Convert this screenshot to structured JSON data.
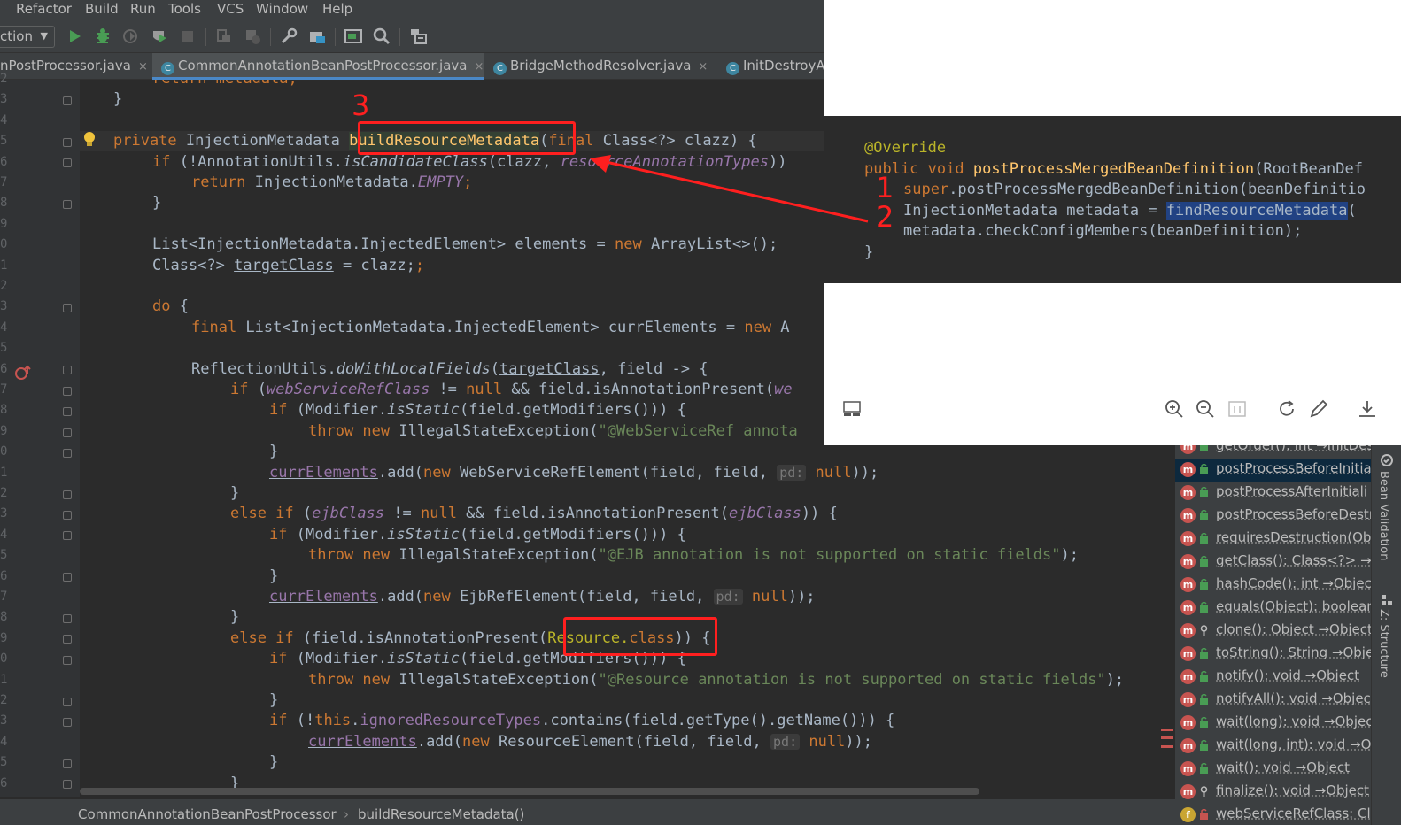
{
  "menu": [
    "Refactor",
    "Build",
    "Run",
    "Tools",
    "VCS",
    "Window",
    "Help"
  ],
  "toolbar": {
    "config_label": "ction",
    "icons": [
      "run-icon",
      "debug-icon",
      "coverage-icon",
      "profile-icon",
      "stop-icon",
      "build-icon",
      "rebuild-icon",
      "settings-icon",
      "project-structure-icon",
      "terminal-icon",
      "search-icon",
      "sdk-icon"
    ]
  },
  "tabs": [
    {
      "label": "nPostProcessor.java",
      "icon": false
    },
    {
      "label": "CommonAnnotationBeanPostProcessor.java",
      "icon": true,
      "active": true
    },
    {
      "label": "BridgeMethodResolver.java",
      "icon": true
    },
    {
      "label": "InitDestroyA",
      "icon": true
    }
  ],
  "tab_icon_letter": "C",
  "tab_close": "×",
  "line_numbers": [
    "2",
    "3",
    "4",
    "5",
    "6",
    "7",
    "8",
    "9",
    "0",
    "1",
    "2",
    "3",
    "4",
    "5",
    "6",
    "7",
    "8",
    "9",
    "0",
    "1",
    "2",
    "3",
    "4",
    "5",
    "6",
    "7",
    "8",
    "9",
    "0",
    "1",
    "2",
    "3",
    "4",
    "5",
    "6"
  ],
  "code": {
    "l2": "return metadata;",
    "l3": "}",
    "l5_a": "private ",
    "l5_b": "InjectionMetadata ",
    "l5_c": "buildResourceMetadata",
    "l5_d": "(",
    "l5_e": "final ",
    "l5_f": "Class<?> clazz) {",
    "l6_a": "if ",
    "l6_b": "(!AnnotationUtils.",
    "l6_c": "isCandidateClass",
    "l6_d": "(clazz, ",
    "l6_e": "resourceAnnotationTypes",
    "l6_f": "))",
    "l7_a": "return ",
    "l7_b": "InjectionMetadata.",
    "l7_c": "EMPTY",
    "l7_d": ";",
    "l8": "}",
    "l10_a": "List<InjectionMetadata.InjectedElement> elements = ",
    "l10_b": "new ",
    "l10_c": "ArrayList<>();",
    "l11_a": "Class<?> ",
    "l11_b": "targetClass",
    "l11_c": " = clazz;",
    "l13_a": "do ",
    "l13_b": "{",
    "l14_a": "final ",
    "l14_b": "List<InjectionMetadata.InjectedElement> currElements = ",
    "l14_c": "new ",
    "l14_d": "A",
    "l16_a": "ReflectionUtils.",
    "l16_b": "doWithLocalFields",
    "l16_c": "(",
    "l16_d": "targetClass",
    "l16_e": ", field -> {",
    "l17_a": "if ",
    "l17_b": "(",
    "l17_c": "webServiceRefClass",
    "l17_d": " != ",
    "l17_e": "null ",
    "l17_f": "&& field.isAnnotationPresent(",
    "l17_g": "we",
    "l18_a": "if ",
    "l18_b": "(Modifier.",
    "l18_c": "isStatic",
    "l18_d": "(field.getModifiers())) {",
    "l19_a": "throw new ",
    "l19_b": "IllegalStateException(",
    "l19_c": "\"@WebServiceRef annota",
    "l20": "}",
    "l21_a": "currElements",
    "l21_b": ".add(",
    "l21_c": "new ",
    "l21_d": "WebServiceRefElement(field, field, ",
    "l21_hint": "pd:",
    "l21_e": " null",
    "l21_f": "));",
    "l22": "}",
    "l23_a": "else if ",
    "l23_b": "(",
    "l23_c": "ejbClass",
    "l23_d": " != ",
    "l23_e": "null ",
    "l23_f": "&& field.isAnnotationPresent(",
    "l23_g": "ejbClass",
    "l23_h": ")) {",
    "l24_a": "if ",
    "l24_b": "(Modifier.",
    "l24_c": "isStatic",
    "l24_d": "(field.getModifiers())) {",
    "l25_a": "throw new ",
    "l25_b": "IllegalStateException(",
    "l25_c": "\"@EJB annotation is not supported on static fields\"",
    "l25_d": ");",
    "l26": "}",
    "l27_a": "currElements",
    "l27_b": ".add(",
    "l27_c": "new ",
    "l27_d": "EjbRefElement(field, field, ",
    "l27_hint": "pd:",
    "l27_e": " null",
    "l27_f": "));",
    "l28": "}",
    "l29_a": "else if ",
    "l29_b": "(field.isAnnotationPresent(",
    "l29_c": "Resource.",
    "l29_d": "class",
    "l29_e": ")) {",
    "l30_a": "if ",
    "l30_b": "(Modifier.",
    "l30_c": "isStatic",
    "l30_d": "(field.getModifiers())) {",
    "l31_a": "throw new ",
    "l31_b": "IllegalStateException(",
    "l31_c": "\"@Resource annotation is not supported on static fields\"",
    "l31_d": ");",
    "l32": "}",
    "l33_a": "if ",
    "l33_b": "(!",
    "l33_c": "this",
    "l33_d": ".",
    "l33_e": "ignoredResourceTypes",
    "l33_f": ".contains(field.getType().getName())) {",
    "l34_a": "currElements",
    "l34_b": ".add(",
    "l34_c": "new ",
    "l34_d": "ResourceElement(field, field, ",
    "l34_hint": "pd:",
    "l34_e": " null",
    "l34_f": "));",
    "l35": "}",
    "l36": "}"
  },
  "breadcrumb": [
    "CommonAnnotationBeanPostProcessor",
    "›",
    "buildResourceMetadata()"
  ],
  "viewer": {
    "s1": "@Override",
    "s2_a": "public ",
    "s2_b": "void ",
    "s2_c": "postProcessMergedBeanDefinition",
    "s2_d": "(RootBeanDef",
    "s3_a": "super",
    "s3_b": ".postProcessMergedBeanDefinition(beanDefinitio",
    "s4_a": "InjectionMetadata metadata = ",
    "s4_b": "findResourceMetadata",
    "s4_c": "(",
    "s5": "metadata.checkConfigMembers(beanDefinition);",
    "s6": "}",
    "tools": [
      "thumbnail-icon",
      "zoom-in-icon",
      "zoom-out-icon",
      "actual-size-icon",
      "rotate-icon",
      "edit-icon",
      "download-icon"
    ]
  },
  "annotations": {
    "n1": "1",
    "n2": "2",
    "n3": "3"
  },
  "structure": [
    {
      "text": "getOrder(): int →InitDes"
    },
    {
      "text": "postProcessBeforeInitia",
      "selected": true
    },
    {
      "text": "postProcessAfterInitiali"
    },
    {
      "text": "postProcessBeforeDestr"
    },
    {
      "text": "requiresDestruction(Ob"
    },
    {
      "text": "getClass(): Class<?> →C"
    },
    {
      "text": "hashCode(): int →Object"
    },
    {
      "text": "equals(Object): boolean"
    },
    {
      "text": "clone(): Object →Object"
    },
    {
      "text": "toString(): String →Obje"
    },
    {
      "text": "notify(): void →Object"
    },
    {
      "text": "notifyAll(): void →Objec"
    },
    {
      "text": "wait(long): void →Objec"
    },
    {
      "text": "wait(long, int): void →O"
    },
    {
      "text": "wait(): void →Object"
    },
    {
      "text": "finalize(): void →Object"
    },
    {
      "text": "webServiceRefClass: Cla"
    }
  ],
  "structure_icon_letter": "m",
  "side_tabs": {
    "bean_validation": "Bean Validation",
    "structure": "Z: Structure"
  },
  "colors": {
    "accent": "#4a88c7",
    "annotation": "#ff1f1f",
    "keyword": "#cc7832",
    "method": "#ffc66d",
    "string": "#6a8759",
    "field": "#9876aa"
  }
}
